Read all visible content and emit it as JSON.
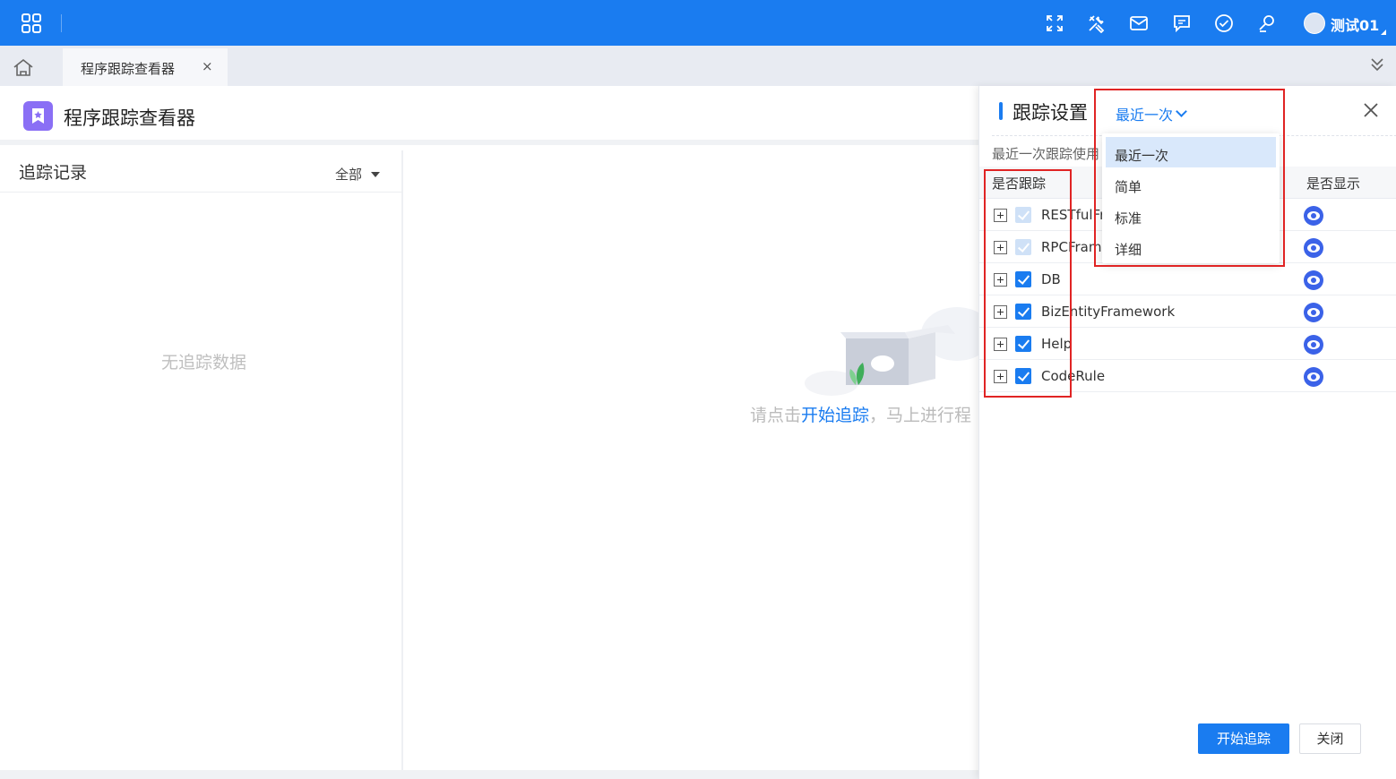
{
  "topbar": {
    "user_name": "测试01",
    "icons": [
      "apps-grid-icon",
      "fullscreen-icon",
      "tools-icon",
      "mail-icon",
      "message-icon",
      "check-circle-icon",
      "user-search-icon"
    ],
    "background": "#1a7cf0"
  },
  "tabs": {
    "home_icon": "home-icon",
    "active_tab": {
      "label": "程序跟踪查看器",
      "close": "×"
    },
    "collapse_icon": "double-chevron-down-icon"
  },
  "page": {
    "title": "程序跟踪查看器",
    "app_icon": "star-badge-icon"
  },
  "left_panel": {
    "title": "追踪记录",
    "filter": "全部",
    "empty_text": "无追踪数据"
  },
  "main": {
    "hint_prefix": "请点击",
    "hint_link": "开始追踪",
    "hint_suffix": "，马上进行程"
  },
  "settings": {
    "title": "跟踪设置",
    "mode_selected": "最近一次",
    "description": "最近一次跟踪使用",
    "columns": {
      "track": "是否跟踪",
      "show": "是否显示"
    },
    "rows": [
      {
        "name": "RESTfulFr",
        "checked": true,
        "disabled": true
      },
      {
        "name": "RPCFrame",
        "checked": true,
        "disabled": true
      },
      {
        "name": "DB",
        "checked": true,
        "disabled": false
      },
      {
        "name": "BizEntityFramework",
        "checked": true,
        "disabled": false
      },
      {
        "name": "Help",
        "checked": true,
        "disabled": false
      },
      {
        "name": "CodeRule",
        "checked": true,
        "disabled": false
      }
    ],
    "dropdown_options": [
      "最近一次",
      "简单",
      "标准",
      "详细"
    ],
    "buttons": {
      "start": "开始追踪",
      "close": "关闭"
    }
  },
  "colors": {
    "primary": "#1a7cf0",
    "eye": "#3b62e8",
    "highlight_box": "#e02424"
  }
}
